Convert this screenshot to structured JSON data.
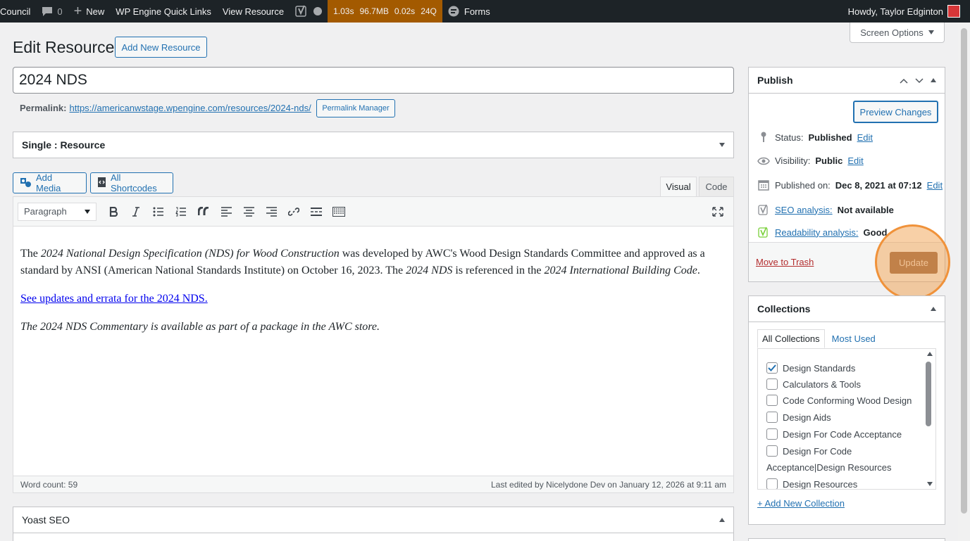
{
  "admin_bar": {
    "site_name": "Council",
    "comments_count": "0",
    "new_label": "New",
    "quick_links": "WP Engine Quick Links",
    "view_resource": "View Resource",
    "perf": [
      "1.03s",
      "96.7MB",
      "0.02s",
      "24Q"
    ],
    "forms": "Forms",
    "greeting": "Howdy, Taylor Edginton"
  },
  "screen_options": "Screen Options",
  "page": {
    "title": "Edit Resource",
    "add_new": "Add New Resource"
  },
  "post": {
    "title": "2024 NDS",
    "permalink_label": "Permalink:",
    "permalink_url": "https://americanwstage.wpengine.com/resources/2024-nds/",
    "permalink_manager": "Permalink Manager"
  },
  "template_select": "Single : Resource",
  "editor": {
    "add_media": "Add Media",
    "all_shortcodes": "All Shortcodes",
    "tab_visual": "Visual",
    "tab_code": "Code",
    "format": "Paragraph",
    "p1_a": "The ",
    "p1_b": "2024 National Design Specification (NDS) for Wood Construction",
    "p1_c": " was developed by AWC's Wood Design Standards Committee and approved as a standard by ANSI (American National Standards Institute) on October 16, 2023. The ",
    "p1_d": "2024 NDS",
    "p1_e": " is referenced in the ",
    "p1_f": "2024 International Building Code",
    "p1_g": ".",
    "link": "See updates and errata for the 2024 NDS.",
    "p3": "The 2024 NDS Commentary is available as part of a package in the AWC store.",
    "word_count": "Word count: 59",
    "last_edited": "Last edited by Nicelydone Dev on January 12, 2026 at 9:11 am"
  },
  "yoast": {
    "title": "Yoast SEO"
  },
  "publish": {
    "title": "Publish",
    "preview": "Preview Changes",
    "status_label": "Status:",
    "status_value": "Published",
    "visibility_label": "Visibility:",
    "visibility_value": "Public",
    "published_label": "Published on:",
    "published_value": "Dec 8, 2021 at 07:12",
    "edit": "Edit",
    "seo_label": "SEO analysis:",
    "seo_value": "Not available",
    "readability_label": "Readability analysis:",
    "readability_value": "Good",
    "trash": "Move to Trash",
    "update": "Update"
  },
  "collections": {
    "title": "Collections",
    "tab_all": "All Collections",
    "tab_used": "Most Used",
    "items": [
      {
        "label": "Design Standards",
        "checked": true
      },
      {
        "label": "Calculators & Tools",
        "checked": false
      },
      {
        "label": "Code Conforming Wood Design",
        "checked": false
      },
      {
        "label": "Design Aids",
        "checked": false
      },
      {
        "label": "Design For Code Acceptance",
        "checked": false
      },
      {
        "label": "Design For Code",
        "checked": false
      },
      {
        "label": "Acceptance|Design Resources",
        "checked": false
      },
      {
        "label": "Design Resources",
        "checked": false
      }
    ],
    "add_new": "+ Add New Collection"
  },
  "colors": {
    "admin_bar": "#1d2327",
    "accent": "#2271b1",
    "update_button": "#9c6f54",
    "highlight": "#f0923a"
  }
}
